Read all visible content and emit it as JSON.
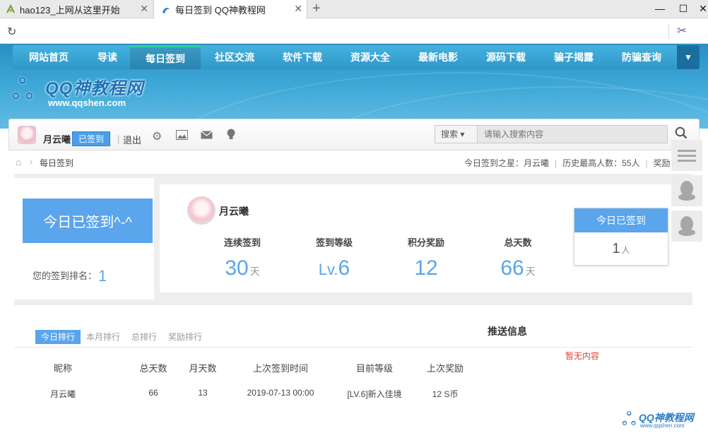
{
  "browser": {
    "tabs": [
      {
        "title": "hao123_上网从这里开始",
        "close": "✕"
      },
      {
        "title": "每日签到 QQ神教程网",
        "close": "✕"
      }
    ],
    "new_tab": "+",
    "win_min": "—",
    "win_max": "☐",
    "win_close": "✕"
  },
  "nav": {
    "items": [
      "网站首页",
      "导读",
      "每日签到",
      "社区交流",
      "软件下载",
      "资源大全",
      "最新电影",
      "源码下载",
      "骗子揭露",
      "防骗查询"
    ],
    "more": "▼"
  },
  "logo": {
    "line1": "QQ神教程网",
    "line2": "www.qqshen.com"
  },
  "userbar": {
    "username": "月云曦",
    "badge": "已签到",
    "logout": "退出",
    "search_category": "搜索 ▾",
    "search_placeholder": "请输入搜索内容"
  },
  "breadcrumb": {
    "current": "每日签到",
    "star_label": "今日签到之星：",
    "star_name": "月云曦",
    "history_max": "历史最高人数：55人",
    "reward": "奖励"
  },
  "sign": {
    "today_button": "今日已签到^-^",
    "rank_label": "您的签到排名：",
    "rank_value": "1",
    "username": "月云曦",
    "stats": [
      {
        "label": "连续签到",
        "value": "30",
        "unit": "天"
      },
      {
        "label": "签到等级",
        "prefix": "Lv.",
        "value": "6",
        "unit": ""
      },
      {
        "label": "积分奖励",
        "value": "12",
        "unit": ""
      },
      {
        "label": "总天数",
        "value": "66",
        "unit": "天"
      }
    ],
    "today_count_title": "今日已签到",
    "today_count_value": "1",
    "today_count_unit": "人"
  },
  "ranking": {
    "tabs": [
      "今日排行",
      "本月排行",
      "总排行",
      "奖励排行"
    ],
    "columns": [
      "昵称",
      "总天数",
      "月天数",
      "上次签到时间",
      "目前等级",
      "上次奖励"
    ],
    "rows": [
      [
        "月云曦",
        "66",
        "13",
        "2019-07-13 00:00",
        "[LV.6]新入佳境",
        "12 S币"
      ]
    ]
  },
  "push": {
    "title": "推送信息",
    "empty": "暂无内容"
  },
  "watermark": {
    "line1": "QQ神教程网",
    "line2": "www.qqshen.com"
  }
}
